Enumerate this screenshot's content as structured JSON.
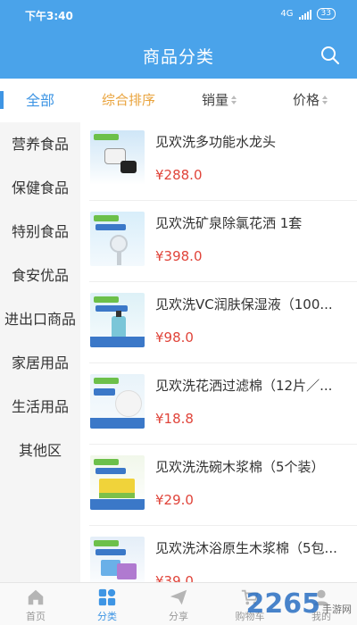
{
  "status_bar": {
    "time": "下午3:40",
    "network": "4G",
    "battery": "33"
  },
  "header": {
    "title": "商品分类"
  },
  "sidebar": {
    "items": [
      {
        "label": "全部"
      },
      {
        "label": "营养食品"
      },
      {
        "label": "保健食品"
      },
      {
        "label": "特别食品"
      },
      {
        "label": "食安优品"
      },
      {
        "label": "进出口商品"
      },
      {
        "label": "家居用品"
      },
      {
        "label": "生活用品"
      },
      {
        "label": "其他区"
      }
    ],
    "active_index": 0
  },
  "sort_bar": {
    "items": [
      {
        "label": "综合排序"
      },
      {
        "label": "销量"
      },
      {
        "label": "价格"
      }
    ]
  },
  "products": [
    {
      "name": "见欢洗多功能水龙头",
      "price": "¥288.0"
    },
    {
      "name": "见欢洗矿泉除氯花洒 1套",
      "price": "¥398.0"
    },
    {
      "name": "见欢洗VC润肤保湿液（100...",
      "price": "¥98.0"
    },
    {
      "name": "见欢洗花洒过滤棉（12片／...",
      "price": "¥18.8"
    },
    {
      "name": "见欢洗洗碗木浆棉（5个装）",
      "price": "¥29.0"
    },
    {
      "name": "见欢洗沐浴原生木浆棉（5包...",
      "price": "¥39.0"
    }
  ],
  "tabbar": {
    "items": [
      {
        "label": "首页"
      },
      {
        "label": "分类"
      },
      {
        "label": "分享"
      },
      {
        "label": "购物车"
      },
      {
        "label": "我的"
      }
    ]
  },
  "watermark": {
    "logo": "2265",
    "site": "手游网"
  },
  "colors": {
    "primary": "#4aa3ea",
    "accent": "#3e95e4",
    "sort_active": "#e9a33c",
    "price": "#e0443a"
  }
}
